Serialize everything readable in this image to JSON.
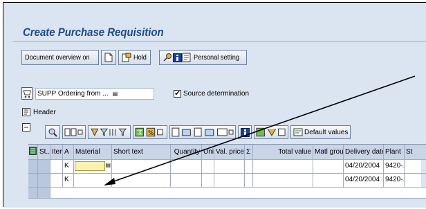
{
  "window": {
    "title": "Create Purchase Requisition"
  },
  "app_toolbar": {
    "doc_overview_label": "Document overview on",
    "hold_label": "Hold",
    "personal_setting_label": "Personal setting"
  },
  "selection": {
    "ordering_value": "SUPP Ordering from ...",
    "source_determination_label": "Source determination",
    "source_determination_checked": true
  },
  "header": {
    "label": "Header"
  },
  "item_toolbar": {
    "default_values_label": "Default values"
  },
  "table": {
    "columns": [
      "St...",
      "Item",
      "A",
      "Material",
      "Short text",
      "Quantity",
      "Unit",
      "Val. price",
      "Σ",
      "Total value",
      "Matl group",
      "Delivery date",
      "Plant",
      "St"
    ],
    "rows": [
      {
        "acct": "K",
        "material": "",
        "delivery_date": "04/20/2004",
        "plant": "9420-..."
      },
      {
        "acct": "K",
        "material": "",
        "delivery_date": "04/20/2004",
        "plant": "9420-..."
      }
    ]
  },
  "colors": {
    "title": "#1f4a86",
    "background": "#dbe4f1",
    "input_highlight": "#fbf2b2"
  }
}
